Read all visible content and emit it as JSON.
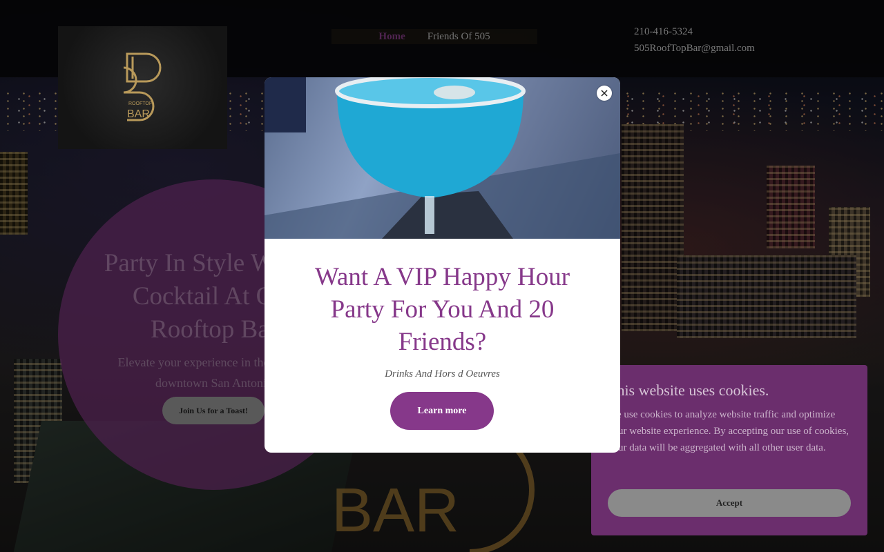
{
  "nav": {
    "items": [
      {
        "label": "Home",
        "active": true
      },
      {
        "label": "Friends Of 505",
        "active": false
      }
    ]
  },
  "contact": {
    "phone": "210-416-5324",
    "email": "505RoofTopBar@gmail.com"
  },
  "logo": {
    "text_small": "ROOFTOP",
    "text_large": "BAR",
    "color": "#b8995a"
  },
  "hero": {
    "title": "Party In Style With A Cocktail At Our Rooftop Bar",
    "subtitle": "Elevate your experience in the heart of downtown San Antonio",
    "button_label": "Join Us for a Toast!"
  },
  "modal": {
    "title": "Want A VIP Happy Hour Party For You And 20 Friends?",
    "subtitle": "Drinks And Hors d Oeuvres",
    "button_label": "Learn more",
    "close_icon": "close-icon",
    "accent_color": "#86388a"
  },
  "cookie": {
    "title": "This website uses cookies.",
    "text": "We use cookies to analyze website traffic and optimize your website experience. By accepting our use of cookies, your data will be aggregated with all other user data.",
    "accept_label": "Accept"
  }
}
